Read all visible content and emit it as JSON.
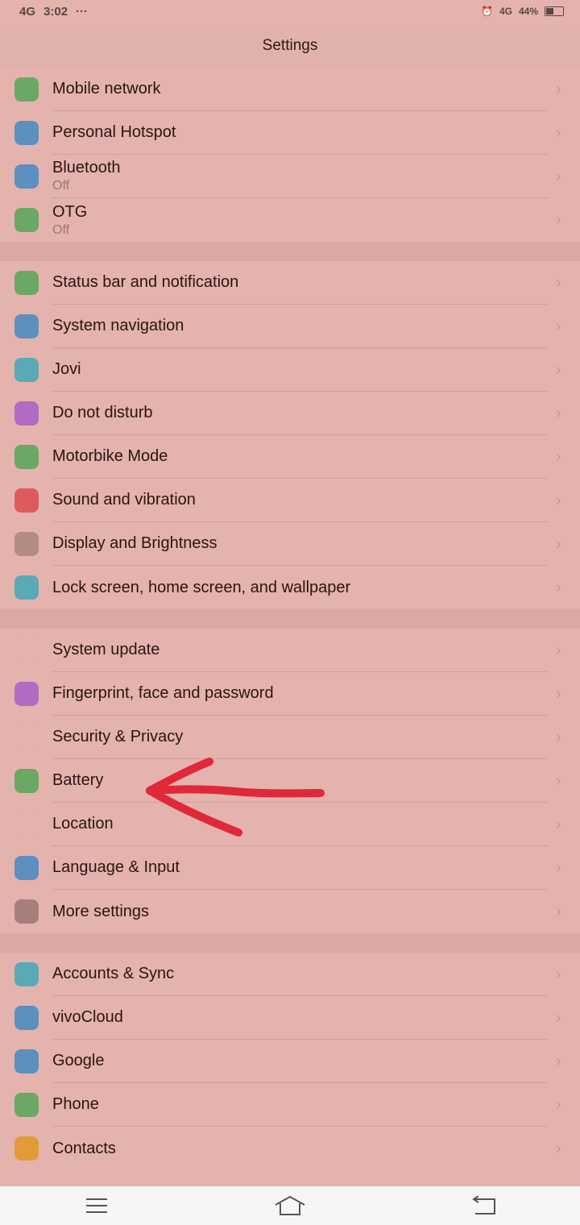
{
  "status": {
    "network": "4G",
    "time": "3:02",
    "dots": "···",
    "right_net": "4G",
    "battery": "44%"
  },
  "header": {
    "title": "Settings"
  },
  "groups": [
    [
      {
        "label": "Mobile network",
        "icon": "globe-icon",
        "color": "#6aa863"
      },
      {
        "label": "Personal Hotspot",
        "icon": "hotspot-icon",
        "color": "#5d8fbf"
      },
      {
        "label": "Bluetooth",
        "sub": "Off",
        "icon": "bluetooth-icon",
        "color": "#5d8fbf"
      },
      {
        "label": "OTG",
        "sub": "Off",
        "icon": "otg-icon",
        "color": "#6aa863"
      }
    ],
    [
      {
        "label": "Status bar and notification",
        "icon": "notification-icon",
        "color": "#6aa863"
      },
      {
        "label": "System navigation",
        "icon": "navigation-icon",
        "color": "#5d8fbf"
      },
      {
        "label": "Jovi",
        "icon": "jovi-icon",
        "color": "#5aa9b6"
      },
      {
        "label": "Do not disturb",
        "icon": "moon-icon",
        "color": "#b16bc1"
      },
      {
        "label": "Motorbike Mode",
        "icon": "motorbike-icon",
        "color": "#6aa863"
      },
      {
        "label": "Sound and vibration",
        "icon": "speaker-icon",
        "color": "#df5b5b"
      },
      {
        "label": "Display and Brightness",
        "icon": "brightness-icon",
        "color": "#b48a84"
      },
      {
        "label": "Lock screen, home screen, and wallpaper",
        "icon": "palette-icon",
        "color": "#5aa9b6"
      }
    ],
    [
      {
        "label": "System update",
        "icon": "update-icon",
        "color": "#e4b3ad"
      },
      {
        "label": "Fingerprint, face and password",
        "icon": "fingerprint-icon",
        "color": "#b16bc1"
      },
      {
        "label": "Security & Privacy",
        "icon": "shield-icon",
        "color": "#e4b3ad"
      },
      {
        "label": "Battery",
        "icon": "battery-icon",
        "color": "#6aa863"
      },
      {
        "label": "Location",
        "icon": "location-icon",
        "color": "#e4b3ad"
      },
      {
        "label": "Language & Input",
        "icon": "keyboard-icon",
        "color": "#5d8fbf"
      },
      {
        "label": "More settings",
        "icon": "gear-icon",
        "color": "#a5807b"
      }
    ],
    [
      {
        "label": "Accounts & Sync",
        "icon": "cloud-sync-icon",
        "color": "#5aa9b6"
      },
      {
        "label": "vivoCloud",
        "icon": "cloud-icon",
        "color": "#5d8fbf"
      },
      {
        "label": "Google",
        "icon": "google-icon",
        "color": "#5d8fbf"
      },
      {
        "label": "Phone",
        "icon": "phone-icon",
        "color": "#6aa863"
      },
      {
        "label": "Contacts",
        "icon": "contacts-icon",
        "color": "#e39b3a"
      }
    ]
  ],
  "annotation_color": "#e02838"
}
